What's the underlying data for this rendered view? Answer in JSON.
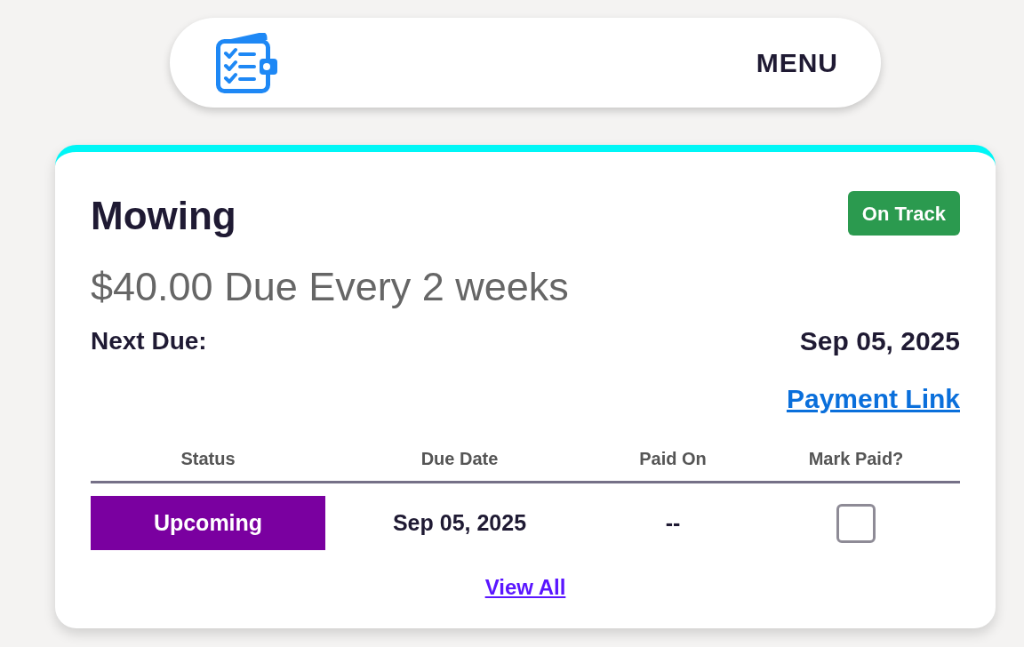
{
  "header": {
    "menu_label": "MENU"
  },
  "card": {
    "title": "Mowing",
    "badge": "On Track",
    "amount_line": "$40.00 Due Every 2 weeks",
    "next_due_label": "Next Due:",
    "next_due_value": "Sep 05, 2025",
    "payment_link": "Payment Link"
  },
  "table": {
    "columns": [
      "Status",
      "Due Date",
      "Paid On",
      "Mark Paid?"
    ],
    "rows": [
      {
        "status": "Upcoming",
        "color": "#7a00a0",
        "due_date": "Sep 05, 2025",
        "paid_on": "--",
        "mark_paid": false
      }
    ]
  },
  "view_all": "View All"
}
